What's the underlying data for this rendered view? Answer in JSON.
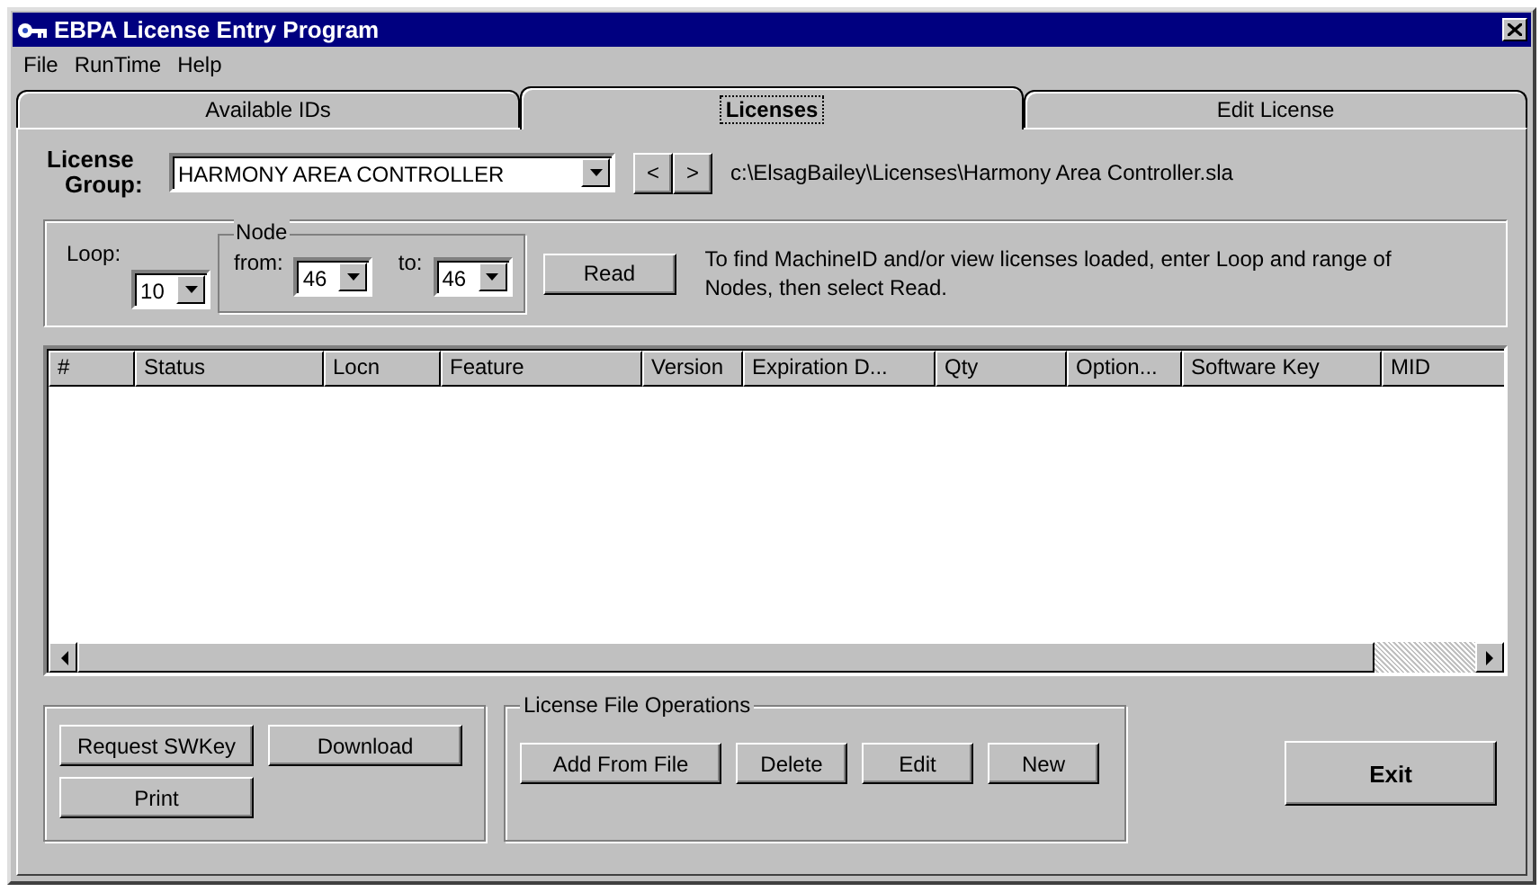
{
  "window": {
    "title": "EBPA License Entry Program"
  },
  "menu": [
    "File",
    "RunTime",
    "Help"
  ],
  "tabs": [
    {
      "label": "Available IDs",
      "selected": false
    },
    {
      "label": "Licenses",
      "selected": true
    },
    {
      "label": "Edit License",
      "selected": false
    }
  ],
  "license_group": {
    "label_line1": "License",
    "label_line2": "Group:",
    "value": "HARMONY AREA CONTROLLER",
    "prev": "<",
    "next": ">",
    "path": "c:\\ElsagBailey\\Licenses\\Harmony Area Controller.sla"
  },
  "read_panel": {
    "loop_label": "Loop:",
    "loop_value": "10",
    "node_title": "Node",
    "from_label": "from:",
    "from_value": "46",
    "to_label": "to:",
    "to_value": "46",
    "read_button": "Read",
    "hint": "To find MachineID and/or view licenses loaded, enter Loop and range of Nodes, then select Read."
  },
  "table": {
    "columns": [
      "#",
      "Status",
      "Locn",
      "Feature",
      "Version",
      "Expiration D...",
      "Qty",
      "Option...",
      "Software Key",
      "MID"
    ]
  },
  "left_buttons": [
    "Request SWKey",
    "Download",
    "Print"
  ],
  "file_ops": {
    "title": "License File Operations",
    "buttons": [
      "Add From File",
      "Delete",
      "Edit",
      "New"
    ]
  },
  "exit_button": "Exit"
}
